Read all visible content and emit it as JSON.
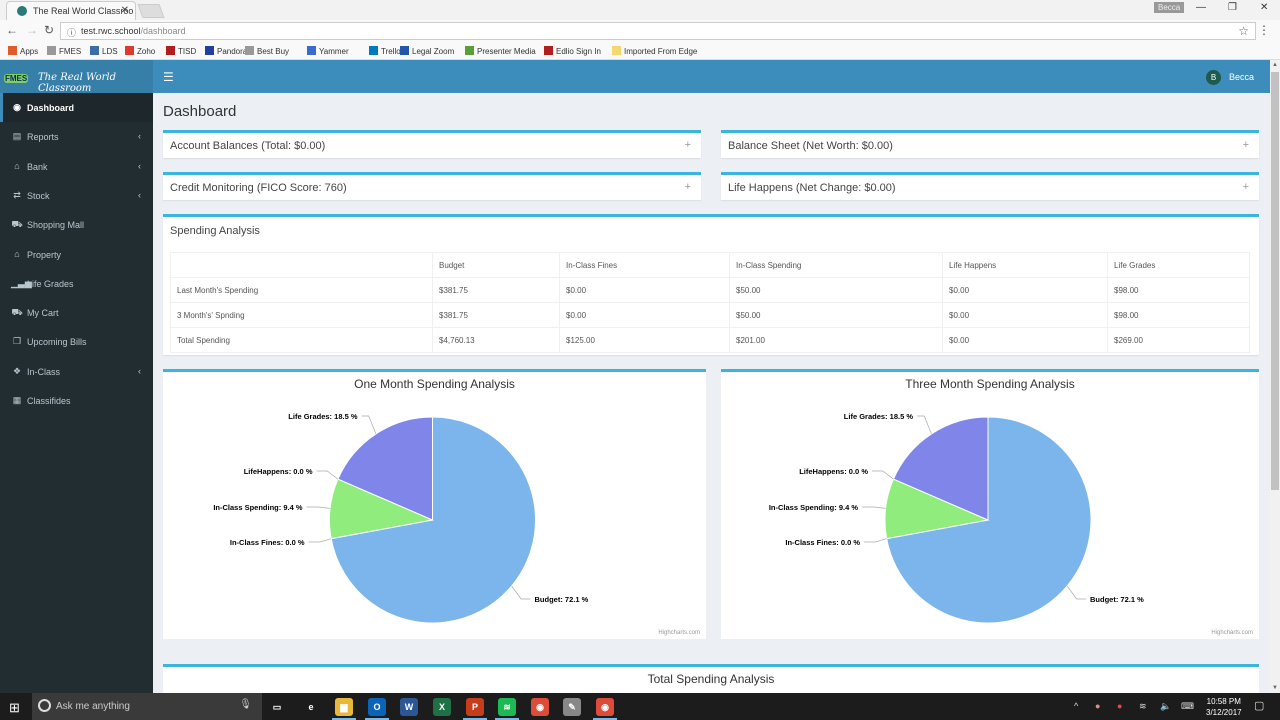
{
  "browser": {
    "tab_title": "The Real World Classroo",
    "url_host": "test.rwc.school",
    "url_path": "/dashboard",
    "profile_name": "Becca",
    "bookmarks": [
      {
        "label": "Apps",
        "icon": "apps-grid-icon",
        "color": "#e25b2a"
      },
      {
        "label": "FMES",
        "icon": "page-icon",
        "color": "#999999"
      },
      {
        "label": "LDS",
        "icon": "lds-icon",
        "color": "#3b6ea5"
      },
      {
        "label": "Zoho",
        "icon": "zoho-icon",
        "color": "#e03a2f"
      },
      {
        "label": "TISD",
        "icon": "tisd-icon",
        "color": "#b01e1e"
      },
      {
        "label": "Pandora",
        "icon": "pandora-icon",
        "color": "#224099"
      },
      {
        "label": "Best Buy",
        "icon": "page-icon",
        "color": "#999999"
      },
      {
        "label": "Yammer",
        "icon": "yammer-icon",
        "color": "#396acc"
      },
      {
        "label": "Trello",
        "icon": "trello-icon",
        "color": "#0079bf"
      },
      {
        "label": "Legal Zoom",
        "icon": "legalzoom-icon",
        "color": "#2356a8"
      },
      {
        "label": "Presenter Media",
        "icon": "presentermedia-icon",
        "color": "#5a9e3a"
      },
      {
        "label": "Edlio Sign In",
        "icon": "edlio-icon",
        "color": "#b01e1e"
      },
      {
        "label": "Imported From Edge",
        "icon": "folder-icon",
        "color": "#f5d76e"
      }
    ]
  },
  "app": {
    "logo_badge": "FMES",
    "logo_text": "The Real World Classroom",
    "user_initial": "B",
    "user_name": "Becca",
    "colors": {
      "header": "#3c8dbc",
      "sidebar": "#222d32",
      "accent": "#3bb5dc"
    }
  },
  "sidebar": {
    "items": [
      {
        "label": "Dashboard",
        "icon": "dashboard-icon",
        "glyph": "◉",
        "active": true,
        "has_children": false
      },
      {
        "label": "Reports",
        "icon": "report-icon",
        "glyph": "▤",
        "active": false,
        "has_children": true
      },
      {
        "label": "Bank",
        "icon": "bank-icon",
        "glyph": "⌂",
        "active": false,
        "has_children": true
      },
      {
        "label": "Stock",
        "icon": "exchange-icon",
        "glyph": "⇄",
        "active": false,
        "has_children": true
      },
      {
        "label": "Shopping Mall",
        "icon": "cart-icon",
        "glyph": "⛟",
        "active": false,
        "has_children": false
      },
      {
        "label": "Property",
        "icon": "home-icon",
        "glyph": "⌂",
        "active": false,
        "has_children": false
      },
      {
        "label": "Life Grades",
        "icon": "signal-icon",
        "glyph": "▁▃▅",
        "active": false,
        "has_children": false
      },
      {
        "label": "My Cart",
        "icon": "cart-icon",
        "glyph": "⛟",
        "active": false,
        "has_children": false
      },
      {
        "label": "Upcoming Bills",
        "icon": "copy-icon",
        "glyph": "❐",
        "active": false,
        "has_children": false
      },
      {
        "label": "In-Class",
        "icon": "cubes-icon",
        "glyph": "❖",
        "active": false,
        "has_children": true
      },
      {
        "label": "Classifides",
        "icon": "newspaper-icon",
        "glyph": "▦",
        "active": false,
        "has_children": false
      }
    ]
  },
  "main": {
    "title": "Dashboard",
    "panels": [
      {
        "title": "Account Balances (Total: $0.00)",
        "toggle": "+"
      },
      {
        "title": "Balance Sheet (Net Worth: $0.00)",
        "toggle": "+"
      },
      {
        "title": "Credit Monitoring (FICO Score: 760)",
        "toggle": "+"
      },
      {
        "title": "Life Happens (Net Change: $0.00)",
        "toggle": "+"
      }
    ],
    "spending": {
      "title": "Spending Analysis",
      "columns": [
        "",
        "Budget",
        "In-Class Fines",
        "In-Class Spending",
        "Life Happens",
        "Life Grades"
      ],
      "rows": [
        [
          "Last Month's Spending",
          "$381.75",
          "$0.00",
          "$50.00",
          "$0.00",
          "$98.00"
        ],
        [
          "3 Month's' Spnding",
          "$381.75",
          "$0.00",
          "$50.00",
          "$0.00",
          "$98.00"
        ],
        [
          "Total Spending",
          "$4,760.13",
          "$125.00",
          "$201.00",
          "$0.00",
          "$269.00"
        ]
      ]
    },
    "bottom_chart_title": "Total Spending Analysis",
    "credits": "Highcharts.com"
  },
  "chart_data": [
    {
      "type": "pie",
      "title": "One Month Spending Analysis",
      "categories": [
        "Budget",
        "In-Class Fines",
        "In-Class Spending",
        "LifeHappens",
        "Life Grades"
      ],
      "values": [
        72.1,
        0.0,
        9.4,
        0.0,
        18.5
      ],
      "labels": [
        "Budget: 72.1 %",
        "In-Class Fines: 0.0 %",
        "In-Class Spending: 9.4 %",
        "LifeHappens: 0.0 %",
        "Life Grades: 18.5 %"
      ],
      "colors": [
        "#7cb5ec",
        "#434348",
        "#90ed7d",
        "#f7a35c",
        "#8085e9"
      ],
      "unit": "%"
    },
    {
      "type": "pie",
      "title": "Three Month Spending Analysis",
      "categories": [
        "Budget",
        "In-Class Fines",
        "In-Class Spending",
        "LifeHappens",
        "Life Grades"
      ],
      "values": [
        72.1,
        0.0,
        9.4,
        0.0,
        18.5
      ],
      "labels": [
        "Budget: 72.1 %",
        "In-Class Fines: 0.0 %",
        "In-Class Spending: 9.4 %",
        "LifeHappens: 0.0 %",
        "Life Grades: 18.5 %"
      ],
      "colors": [
        "#7cb5ec",
        "#434348",
        "#90ed7d",
        "#f7a35c",
        "#8085e9"
      ],
      "unit": "%"
    }
  ],
  "taskbar": {
    "search_placeholder": "Ask me anything",
    "time": "10:58 PM",
    "date": "3/12/2017",
    "apps": [
      {
        "name": "task-view",
        "glyph": "▭",
        "color": "#1c1c1c"
      },
      {
        "name": "edge",
        "glyph": "e",
        "color": "#1c1c1c"
      },
      {
        "name": "file-explorer",
        "glyph": "▆",
        "color": "#e8b83a"
      },
      {
        "name": "outlook",
        "glyph": "O",
        "color": "#0a64b8"
      },
      {
        "name": "word",
        "glyph": "W",
        "color": "#2b5797"
      },
      {
        "name": "excel",
        "glyph": "X",
        "color": "#1e7145"
      },
      {
        "name": "powerpoint",
        "glyph": "P",
        "color": "#c43e1c"
      },
      {
        "name": "spotify",
        "glyph": "≋",
        "color": "#1db954"
      },
      {
        "name": "chrome",
        "glyph": "◉",
        "color": "#dd4b39"
      },
      {
        "name": "paint-tool",
        "glyph": "✎",
        "color": "#888888"
      },
      {
        "name": "chrome-active",
        "glyph": "◉",
        "color": "#dd4b39"
      }
    ]
  }
}
